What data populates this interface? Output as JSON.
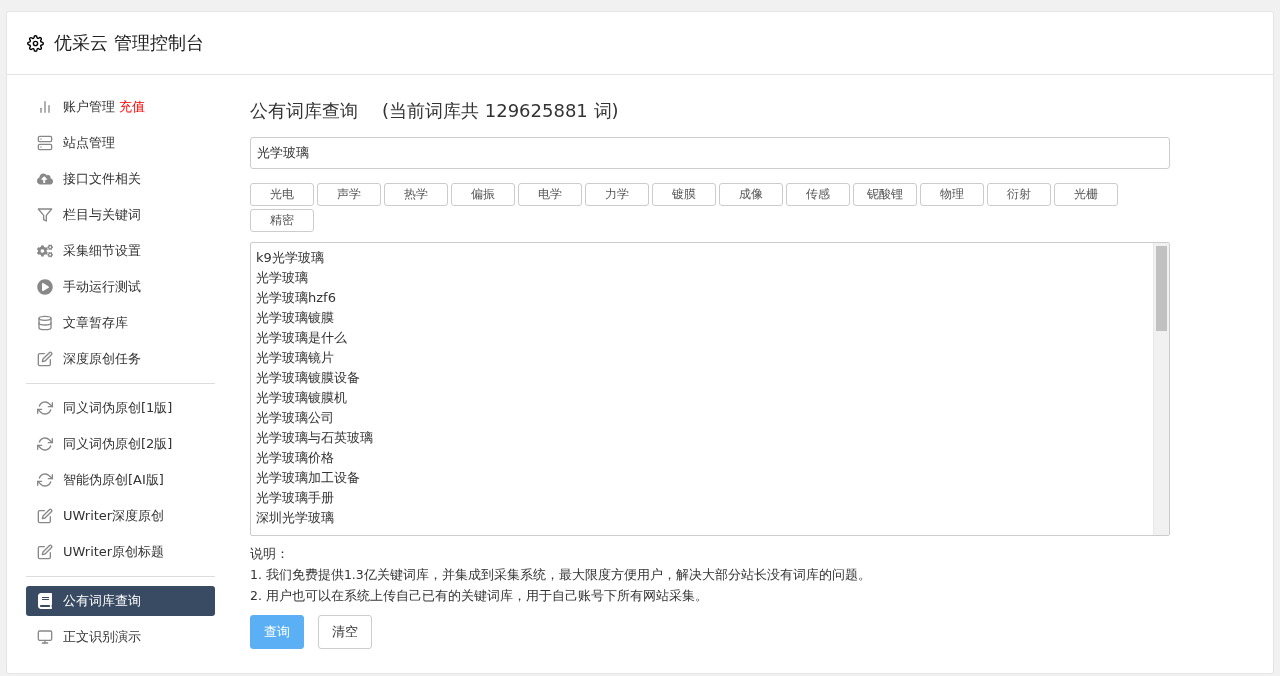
{
  "header": {
    "title": "优采云 管理控制台"
  },
  "sidebar": {
    "groups": [
      {
        "items": [
          {
            "label": "账户管理",
            "badge": "充值",
            "selected": false
          },
          {
            "label": "站点管理",
            "selected": false
          },
          {
            "label": "接口文件相关",
            "selected": false
          },
          {
            "label": "栏目与关键词",
            "selected": false
          },
          {
            "label": "采集细节设置",
            "selected": false
          },
          {
            "label": "手动运行测试",
            "selected": false
          },
          {
            "label": "文章暂存库",
            "selected": false
          },
          {
            "label": "深度原创任务",
            "selected": false
          }
        ]
      },
      {
        "items": [
          {
            "label": "同义词伪原创[1版]",
            "selected": false
          },
          {
            "label": "同义词伪原创[2版]",
            "selected": false
          },
          {
            "label": "智能伪原创[AI版]",
            "selected": false
          },
          {
            "label": "UWriter深度原创",
            "selected": false
          },
          {
            "label": "UWriter原创标题",
            "selected": false
          }
        ]
      },
      {
        "items": [
          {
            "label": "公有词库查询",
            "selected": true
          },
          {
            "label": "正文识别演示",
            "selected": false
          }
        ]
      }
    ]
  },
  "main": {
    "title": "公有词库查询",
    "count_text": "(当前词库共 129625881 词)",
    "search": {
      "value": "光学玻璃"
    },
    "tags": [
      "光电",
      "声学",
      "热学",
      "偏振",
      "电学",
      "力学",
      "镀膜",
      "成像",
      "传感",
      "铌酸锂",
      "物理",
      "衍射",
      "光栅",
      "精密"
    ],
    "results": [
      "k9光学玻璃",
      "光学玻璃",
      "光学玻璃hzf6",
      "光学玻璃镀膜",
      "光学玻璃是什么",
      "光学玻璃镜片",
      "光学玻璃镀膜设备",
      "光学玻璃镀膜机",
      "光学玻璃公司",
      "光学玻璃与石英玻璃",
      "光学玻璃价格",
      "光学玻璃加工设备",
      "光学玻璃手册",
      "深圳光学玻璃"
    ],
    "notes_title": "说明：",
    "notes": [
      "1. 我们免费提供1.3亿关键词库，并集成到采集系统，最大限度方便用户，解决大部分站长没有词库的问题。",
      "2. 用户也可以在系统上传自己已有的关键词库，用于自己账号下所有网站采集。"
    ],
    "buttons": [
      {
        "label": "查询",
        "kind": "primary"
      },
      {
        "label": "清空",
        "kind": "default"
      }
    ]
  }
}
